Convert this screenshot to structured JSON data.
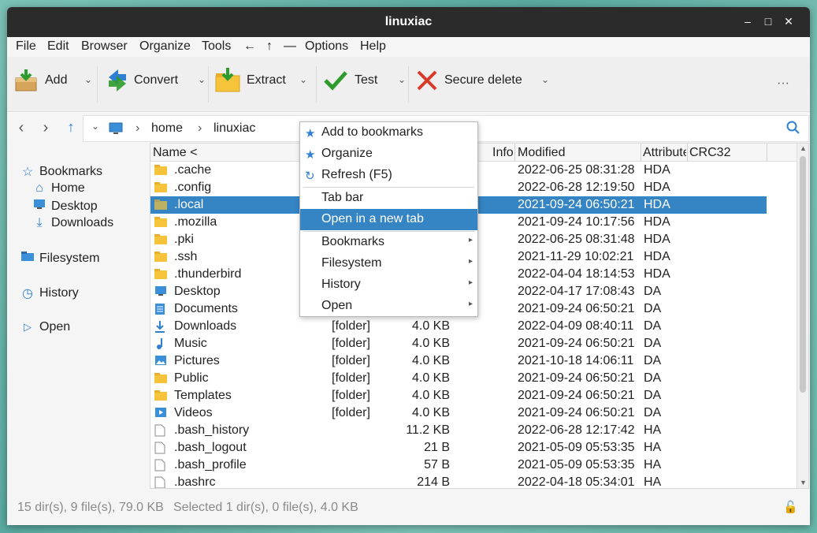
{
  "window": {
    "title": "linuxiac"
  },
  "menubar": [
    "File",
    "Edit",
    "Browser",
    "Organize",
    "Tools",
    "←",
    "↑",
    "—",
    "Options",
    "Help"
  ],
  "toolbar": {
    "add": "Add",
    "convert": "Convert",
    "extract": "Extract",
    "test": "Test",
    "secure_delete": "Secure delete",
    "more": "···"
  },
  "address": {
    "crumbs": [
      "home",
      "linuxiac"
    ]
  },
  "sidebar": {
    "bookmarks": "Bookmarks",
    "home": "Home",
    "desktop": "Desktop",
    "downloads": "Downloads",
    "filesystem": "Filesystem",
    "history": "History",
    "open": "Open"
  },
  "columns": {
    "name": "Name <",
    "info": "Info",
    "modified": "Modified",
    "attributes": "Attribute",
    "crc": "CRC32"
  },
  "files": [
    {
      "name": ".cache",
      "type": "",
      "size": "",
      "modified": "2022-06-25 08:31:28",
      "attr": "HDA",
      "icon": "folder"
    },
    {
      "name": ".config",
      "type": "",
      "size": "",
      "modified": "2022-06-28 12:19:50",
      "attr": "HDA",
      "icon": "folder"
    },
    {
      "name": ".local",
      "type": "",
      "size": "",
      "modified": "2021-09-24 06:50:21",
      "attr": "HDA",
      "icon": "folder"
    },
    {
      "name": ".mozilla",
      "type": "",
      "size": "",
      "modified": "2021-09-24 10:17:56",
      "attr": "HDA",
      "icon": "folder"
    },
    {
      "name": ".pki",
      "type": "",
      "size": "",
      "modified": "2022-06-25 08:31:48",
      "attr": "HDA",
      "icon": "folder"
    },
    {
      "name": ".ssh",
      "type": "",
      "size": "",
      "modified": "2021-11-29 10:02:21",
      "attr": "HDA",
      "icon": "folder"
    },
    {
      "name": ".thunderbird",
      "type": "",
      "size": "",
      "modified": "2022-04-04 18:14:53",
      "attr": "HDA",
      "icon": "folder"
    },
    {
      "name": "Desktop",
      "type": "",
      "size": "",
      "modified": "2022-04-17 17:08:43",
      "attr": "DA",
      "icon": "desktop"
    },
    {
      "name": "Documents",
      "type": "",
      "size": "",
      "modified": "2021-09-24 06:50:21",
      "attr": "DA",
      "icon": "documents"
    },
    {
      "name": "Downloads",
      "type": "[folder]",
      "size": "4.0 KB",
      "modified": "2022-04-09 08:40:11",
      "attr": "DA",
      "icon": "downloads"
    },
    {
      "name": "Music",
      "type": "[folder]",
      "size": "4.0 KB",
      "modified": "2021-09-24 06:50:21",
      "attr": "DA",
      "icon": "music"
    },
    {
      "name": "Pictures",
      "type": "[folder]",
      "size": "4.0 KB",
      "modified": "2021-10-18 14:06:11",
      "attr": "DA",
      "icon": "pictures"
    },
    {
      "name": "Public",
      "type": "[folder]",
      "size": "4.0 KB",
      "modified": "2021-09-24 06:50:21",
      "attr": "DA",
      "icon": "folder"
    },
    {
      "name": "Templates",
      "type": "[folder]",
      "size": "4.0 KB",
      "modified": "2021-09-24 06:50:21",
      "attr": "DA",
      "icon": "folder"
    },
    {
      "name": "Videos",
      "type": "[folder]",
      "size": "4.0 KB",
      "modified": "2021-09-24 06:50:21",
      "attr": "DA",
      "icon": "videos"
    },
    {
      "name": ".bash_history",
      "type": "",
      "size": "11.2 KB",
      "modified": "2022-06-28 12:17:42",
      "attr": "HA",
      "icon": "file"
    },
    {
      "name": ".bash_logout",
      "type": "",
      "size": "21 B",
      "modified": "2021-05-09 05:53:35",
      "attr": "HA",
      "icon": "file"
    },
    {
      "name": ".bash_profile",
      "type": "",
      "size": "57 B",
      "modified": "2021-05-09 05:53:35",
      "attr": "HA",
      "icon": "file"
    },
    {
      "name": ".bashrc",
      "type": "",
      "size": "214 B",
      "modified": "2022-04-18 05:34:01",
      "attr": "HA",
      "icon": "file"
    }
  ],
  "selected_row": 2,
  "context_menu": {
    "add_bookmark": "Add to bookmarks",
    "organize": "Organize",
    "refresh": "Refresh (F5)",
    "tab_bar": "Tab bar",
    "open_new_tab": "Open in a new tab",
    "bookmarks": "Bookmarks",
    "filesystem": "Filesystem",
    "history": "History",
    "open": "Open"
  },
  "status": {
    "summary": "15 dir(s), 9 file(s), 79.0 KB",
    "selection": "Selected 1 dir(s), 0 file(s), 4.0 KB"
  },
  "colors": {
    "selection": "#3584c4",
    "titlebar": "#2b2b2b",
    "folder": "#f6c43a"
  }
}
